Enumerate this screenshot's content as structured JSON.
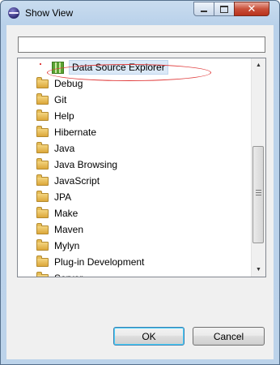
{
  "window": {
    "title": "Show View",
    "close_glyph": "✕"
  },
  "filter": {
    "value": "",
    "placeholder": ""
  },
  "tree": {
    "selected_item": "Data Source Explorer",
    "folders": [
      "Debug",
      "Git",
      "Help",
      "Hibernate",
      "Java",
      "Java Browsing",
      "JavaScript",
      "JPA",
      "Make",
      "Maven",
      "Mylyn",
      "Plug-in Development",
      "Server"
    ]
  },
  "buttons": {
    "ok": "OK",
    "cancel": "Cancel"
  },
  "colors": {
    "highlight_ellipse": "#e03a3a",
    "titlebar": "#b9d1ea"
  }
}
